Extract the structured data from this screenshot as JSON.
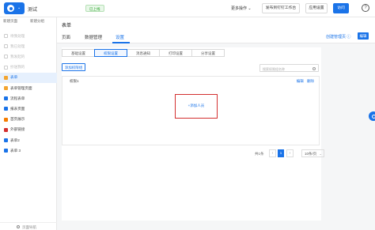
{
  "topbar": {
    "app_title": "测试",
    "status": "已上线",
    "more_ops": "更多操作 ⌄",
    "publish_label": "发布到钉钉工作台",
    "app_settings_label": "应用设置",
    "visit_label": "访问",
    "help_icon": "?"
  },
  "sidebar": {
    "top_items": [
      "新建页面",
      "新建分组"
    ],
    "items": [
      {
        "label": "待我处理",
        "state": "disabled",
        "icon_color": "#cccccc"
      },
      {
        "label": "我已处理",
        "state": "disabled",
        "icon_color": "#cccccc"
      },
      {
        "label": "我发起的",
        "state": "disabled",
        "icon_color": "#cccccc"
      },
      {
        "label": "抄送我的",
        "state": "disabled",
        "icon_color": "#cccccc"
      },
      {
        "label": "表单",
        "state": "active",
        "icon_color": "#f3a531"
      },
      {
        "label": "表单管理页面",
        "state": "normal",
        "icon_color": "#f3a531"
      },
      {
        "label": "流程表单",
        "state": "normal",
        "icon_color": "#1a73e8"
      },
      {
        "label": "报表页面",
        "state": "normal",
        "icon_color": "#1a73e8"
      },
      {
        "label": "首页展示",
        "state": "normal",
        "icon_color": "#f57c00"
      },
      {
        "label": "外部链接",
        "state": "normal",
        "icon_color": "#d32f2f"
      },
      {
        "label": "表单2",
        "state": "normal",
        "icon_color": "#1a73e8"
      },
      {
        "label": "表单 3",
        "state": "normal",
        "icon_color": "#1a73e8"
      }
    ],
    "bottom_label": "页面导航"
  },
  "header": {
    "title": "表单",
    "tabs": [
      "页面",
      "数据管理",
      "设置"
    ],
    "active_tab": "设置",
    "create_admin_label": "创建管理页 ⓘ",
    "edit_label": "编辑"
  },
  "content": {
    "sub_tabs": [
      "基础设置",
      "权限设置",
      "消息通知",
      "打印设置",
      "分享设置"
    ],
    "active_sub_tab": "权限设置",
    "add_group_label": "添加权限组",
    "search_placeholder": "搜索权限组名称",
    "group": {
      "name": "权限1",
      "actions": [
        "编辑",
        "删除"
      ],
      "add_person_label": "+添加人员"
    },
    "pager": {
      "total": "共1条",
      "prev": "‹",
      "page": "1",
      "next": "›",
      "page_size": "10条/页"
    }
  },
  "colors": {
    "accent": "#1a73e8",
    "highlight_box": "#d32f2f"
  }
}
